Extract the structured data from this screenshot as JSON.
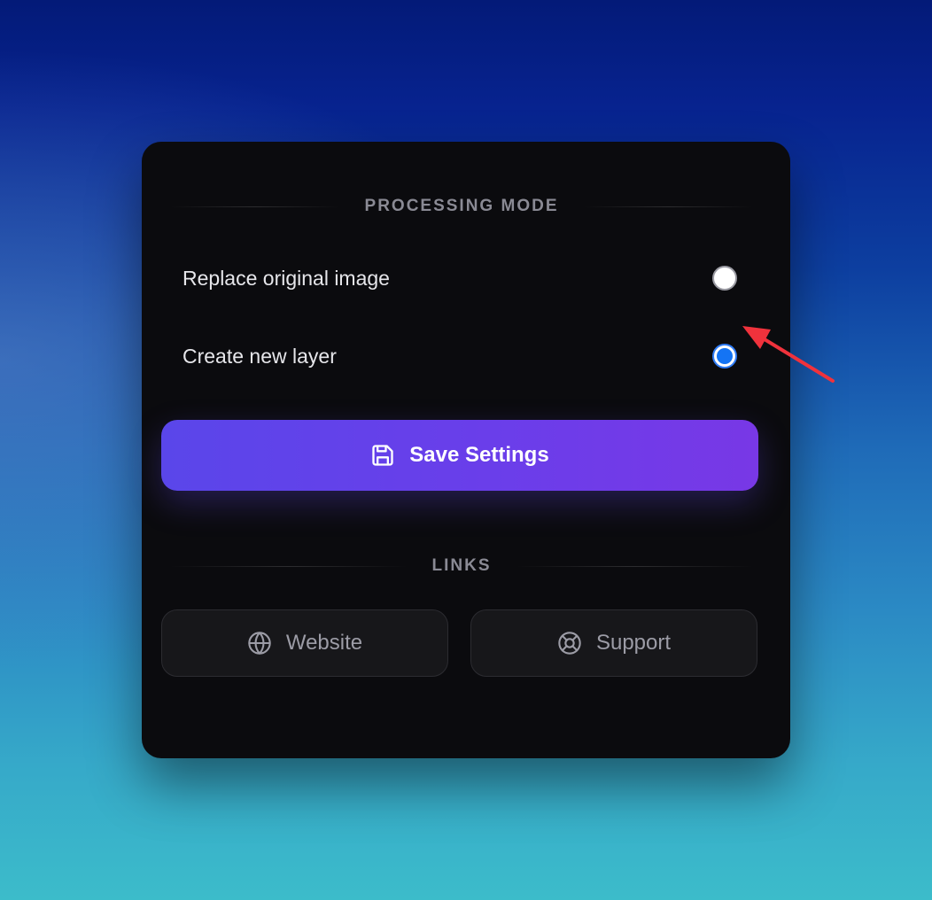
{
  "processing_mode": {
    "title": "PROCESSING MODE",
    "options": [
      {
        "label": "Replace original image",
        "selected": false
      },
      {
        "label": "Create new layer",
        "selected": true
      }
    ]
  },
  "save_button": {
    "label": "Save Settings",
    "icon": "save-icon"
  },
  "links": {
    "title": "LINKS",
    "items": [
      {
        "label": "Website",
        "icon": "globe-icon"
      },
      {
        "label": "Support",
        "icon": "lifebuoy-icon"
      }
    ]
  },
  "colors": {
    "accent_start": "#5a46ea",
    "accent_end": "#7838e6",
    "radio_selected": "#1474f4",
    "panel_bg": "#0b0b0e",
    "annotation_arrow": "#f0323c"
  }
}
